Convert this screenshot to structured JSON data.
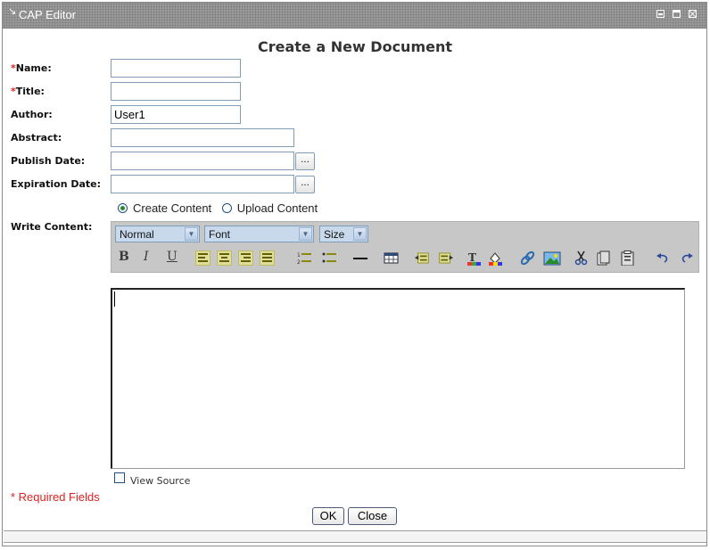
{
  "window": {
    "title": "CAP Editor"
  },
  "form": {
    "heading": "Create a New Document",
    "required_mark": "*",
    "name_label": "Name:",
    "title_label": "Title:",
    "author_label": "Author:",
    "author_value": "User1",
    "abstract_label": "Abstract:",
    "publish_date_label": "Publish Date:",
    "expiration_date_label": "Expiration Date:",
    "date_picker_label": "...",
    "write_content_label": "Write Content:",
    "create_content_label": "Create Content",
    "upload_content_label": "Upload Content",
    "view_source_label": "View Source",
    "required_fields_note": "* Required Fields",
    "ok_label": "OK",
    "close_label": "Close"
  },
  "toolbar": {
    "format_value": "Normal",
    "font_value": "Font",
    "size_value": "Size",
    "bold": "B",
    "italic": "I",
    "underline": "U"
  },
  "colors": {
    "required": "#d22222",
    "titlebar": "#9a9a9a",
    "toolbar": "#c7c7c7"
  }
}
